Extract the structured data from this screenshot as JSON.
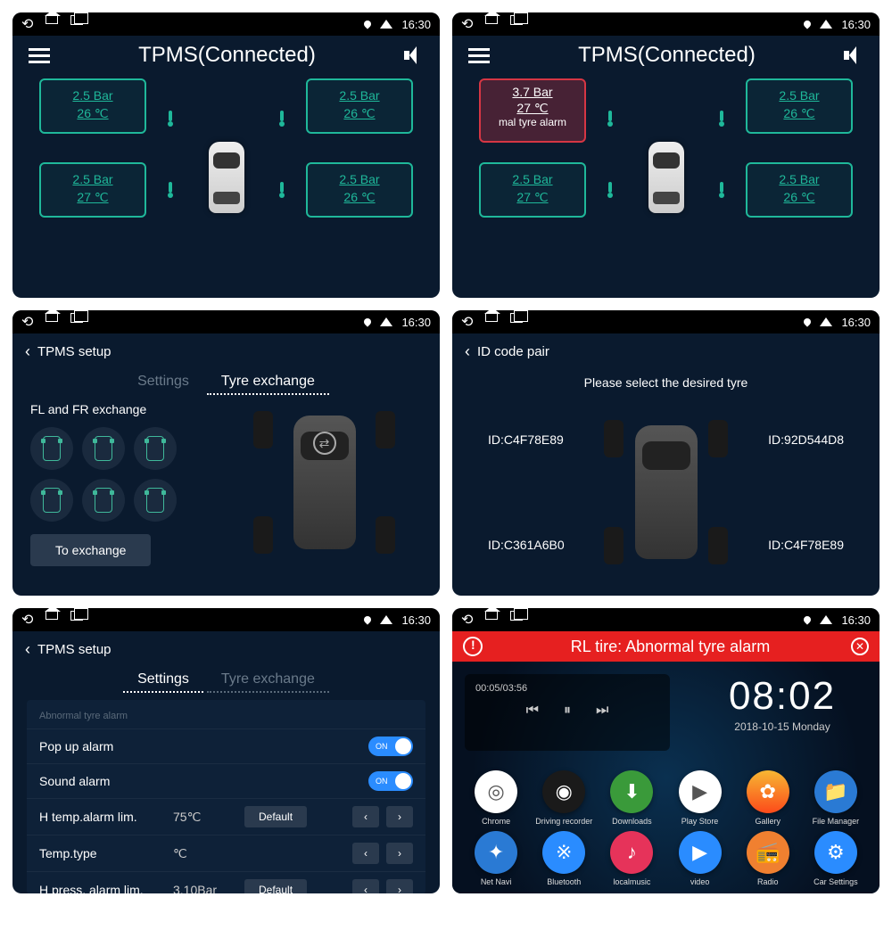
{
  "status": {
    "time": "16:30"
  },
  "tpms": {
    "title": "TPMS(Connected)",
    "tires_normal": {
      "fl": {
        "pressure": "2.5  Bar",
        "temp": "26  ℃"
      },
      "fr": {
        "pressure": "2.5  Bar",
        "temp": "26  ℃"
      },
      "rl": {
        "pressure": "2.5  Bar",
        "temp": "27  ℃"
      },
      "rr": {
        "pressure": "2.5  Bar",
        "temp": "26  ℃"
      }
    },
    "tires_alarm": {
      "fl": {
        "pressure": "3.7  Bar",
        "temp": "27  ℃",
        "msg": "mal tyre alarm"
      },
      "fr": {
        "pressure": "2.5  Bar",
        "temp": "26  ℃"
      },
      "rl": {
        "pressure": "2.5  Bar",
        "temp": "27  ℃"
      },
      "rr": {
        "pressure": "2.5  Bar",
        "temp": "26  ℃"
      }
    }
  },
  "setup": {
    "title": "TPMS setup",
    "tab_settings": "Settings",
    "tab_tyre_ex": "Tyre exchange",
    "exchange_label": "FL and FR exchange",
    "exchange_btn": "To exchange"
  },
  "idpair": {
    "title": "ID code pair",
    "prompt": "Please select the desired tyre",
    "fl": "ID:C4F78E89",
    "fr": "ID:92D544D8",
    "rl": "ID:C361A6B0",
    "rr": "ID:C4F78E89"
  },
  "settings": {
    "section": "Abnormal tyre alarm",
    "popup": "Pop up alarm",
    "sound": "Sound alarm",
    "toggle_on": "ON",
    "htemp_label": "H temp.alarm lim.",
    "htemp_val": "75℃",
    "ttype_label": "Temp.type",
    "ttype_val": "℃",
    "hpress_label": "H press. alarm lim.",
    "hpress_val": "3.10Bar",
    "default": "Default"
  },
  "launcher": {
    "alarm": "RL tire: Abnormal tyre alarm",
    "media_progress": "00:05/03:56",
    "time": "08:02",
    "date": "2018-10-15  Monday",
    "apps": [
      {
        "name": "Chrome",
        "color": "#fff",
        "glyph": "◎"
      },
      {
        "name": "Driving recorder",
        "color": "#1a1a1a",
        "glyph": "◉"
      },
      {
        "name": "Downloads",
        "color": "#3a9a3a",
        "glyph": "⬇"
      },
      {
        "name": "Play Store",
        "color": "#fff",
        "glyph": "▶"
      },
      {
        "name": "Gallery",
        "color": "linear-gradient(#f7b733,#fc4a1a)",
        "glyph": "✿"
      },
      {
        "name": "File Manager",
        "color": "#2a7ad4",
        "glyph": "📁"
      },
      {
        "name": "Net Navi",
        "color": "#2a7ad4",
        "glyph": "✦"
      },
      {
        "name": "Bluetooth",
        "color": "#2a8cff",
        "glyph": "※"
      },
      {
        "name": "localmusic",
        "color": "#e6335a",
        "glyph": "♪"
      },
      {
        "name": "video",
        "color": "#2a8cff",
        "glyph": "▶"
      },
      {
        "name": "Radio",
        "color": "#f08030",
        "glyph": "📻"
      },
      {
        "name": "Car Settings",
        "color": "#2a8cff",
        "glyph": "⚙"
      }
    ]
  }
}
